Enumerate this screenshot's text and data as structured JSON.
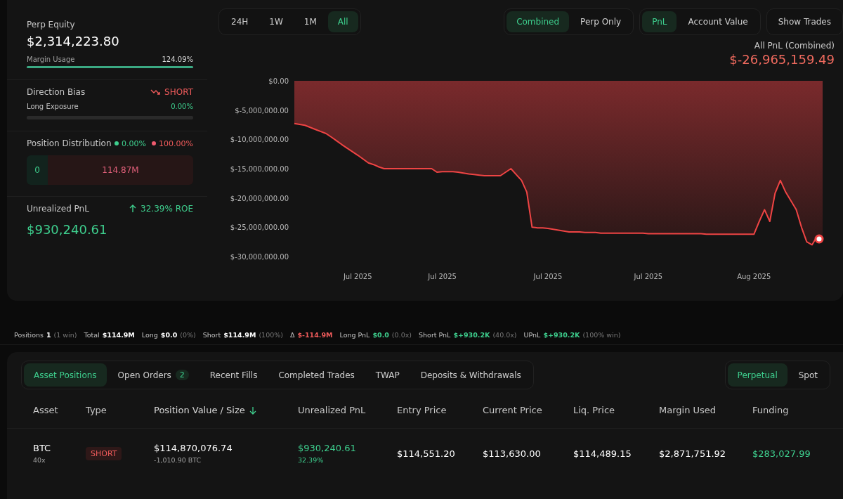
{
  "summary": {
    "perp_equity": {
      "label": "Perp Equity",
      "value": "$2,314,223.80"
    },
    "margin_usage": {
      "label": "Margin Usage",
      "value": "124.09%",
      "level": 1
    },
    "direction_bias": {
      "label": "Direction Bias",
      "value": "SHORT"
    },
    "long_exposure": {
      "label": "Long Exposure",
      "value": "0.00%",
      "level": 0
    },
    "position_distribution": {
      "label": "Position Distribution",
      "long_pct": "0.00%",
      "short_pct": "100.00%",
      "long_value": "0",
      "short_value": "114.87M"
    },
    "unrealized_pnl": {
      "label": "Unrealized PnL",
      "roe": "32.39% ROE",
      "value": "$930,240.61"
    }
  },
  "range_tabs": [
    {
      "label": "24H",
      "selected": false
    },
    {
      "label": "1W",
      "selected": false
    },
    {
      "label": "1M",
      "selected": false
    },
    {
      "label": "All",
      "selected": true
    }
  ],
  "mode_tabs": [
    {
      "label": "Combined",
      "selected": true
    },
    {
      "label": "Perp Only",
      "selected": false
    }
  ],
  "metric_tabs": [
    {
      "label": "PnL",
      "selected": true
    },
    {
      "label": "Account Value",
      "selected": false
    }
  ],
  "show_trades": "Show Trades",
  "chart_header": {
    "label": "All PnL (Combined)",
    "value": "$-26,965,159.49"
  },
  "chart_data": {
    "type": "area",
    "categories": [
      null,
      null,
      null,
      null,
      null,
      null,
      null,
      null,
      null,
      null,
      null,
      null,
      "Jul 2025",
      null,
      null,
      null,
      null,
      null,
      null,
      null,
      null,
      null,
      null,
      null,
      null,
      null,
      null,
      null,
      "Jul 2025",
      null,
      null,
      null,
      null,
      null,
      null,
      null,
      null,
      null,
      null,
      null,
      null,
      null,
      null,
      null,
      null,
      null,
      null,
      null,
      "Jul 2025",
      null,
      null,
      null,
      null,
      null,
      null,
      null,
      null,
      null,
      null,
      null,
      null,
      null,
      null,
      null,
      null,
      null,
      null,
      "Jul 2025",
      null,
      null,
      null,
      null,
      null,
      null,
      null,
      null,
      null,
      null,
      null,
      null,
      null,
      null,
      null,
      null,
      null,
      null,
      null,
      "Aug 2025",
      null,
      null,
      null,
      null,
      null,
      null,
      null,
      null,
      null,
      null,
      null,
      null,
      null
    ],
    "series": [
      {
        "color": "#ef4444",
        "values": [
          -7300000,
          -7450000,
          -7600000,
          -7950000,
          -8300000,
          -8650000,
          -9000000,
          -9600000,
          -10250000,
          -10900000,
          -11500000,
          -12100000,
          -12700000,
          -13350000,
          -14000000,
          -14300000,
          -14700000,
          -15000000,
          -15000000,
          -15000000,
          -15000000,
          -15000000,
          -15000000,
          -15000000,
          -15000000,
          -15000000,
          -15000000,
          -15600000,
          -15500000,
          -15500000,
          -15500000,
          -15600000,
          -15750000,
          -15900000,
          -16000000,
          -16100000,
          -16200000,
          -16200000,
          -16200000,
          -16200000,
          -15600000,
          -15000000,
          -16000000,
          -17000000,
          -19000000,
          -25000000,
          -25100000,
          -25100000,
          -25200000,
          -25350000,
          -25500000,
          -25650000,
          -25800000,
          -25800000,
          -25800000,
          -25900000,
          -25900000,
          -25900000,
          -26000000,
          -26000000,
          -26000000,
          -26000000,
          -26000000,
          -26000000,
          -26000000,
          -26000000,
          -26000000,
          -26100000,
          -26100000,
          -26100000,
          -26100000,
          -26100000,
          -26100000,
          -26100000,
          -26100000,
          -26100000,
          -26100000,
          -26100000,
          -26200000,
          -26200000,
          -26200000,
          -26200000,
          -26200000,
          -26200000,
          -26200000,
          -26200000,
          -26200000,
          -26200000,
          -24000000,
          -22000000,
          -24000000,
          -19200000,
          -17000000,
          -19000000,
          -20500000,
          -22000000,
          -25000000,
          -27500000,
          -28000000,
          -26500000,
          -27000000
        ]
      }
    ],
    "ylim": [
      -30000000,
      0
    ],
    "yticks": [
      {
        "value": 0,
        "label": "$0.00"
      },
      {
        "value": -5000000,
        "label": "$-5,000,000.00"
      },
      {
        "value": -10000000,
        "label": "$-10,000,000.00"
      },
      {
        "value": -15000000,
        "label": "$-15,000,000.00"
      },
      {
        "value": -20000000,
        "label": "$-20,000,000.00"
      },
      {
        "value": -25000000,
        "label": "$-25,000,000.00"
      },
      {
        "value": -30000000,
        "label": "$-30,000,000.00"
      }
    ]
  },
  "stats": [
    {
      "label": "Positions",
      "value": "1",
      "note": "(1 win)",
      "color": "#ffffff"
    },
    {
      "label": "Total",
      "value": "$114.9M",
      "color": "#ffffff"
    },
    {
      "label": "Long",
      "value": "$0.0",
      "note": "(0%)",
      "color": "#ffffff"
    },
    {
      "label": "Short",
      "value": "$114.9M",
      "note": "(100%)",
      "color": "#ffffff"
    },
    {
      "label": "Δ",
      "value": "$-114.9M",
      "color": "#ef5b5b"
    },
    {
      "label": "Long PnL",
      "value": "$0.0",
      "note": "(0.0x)",
      "color": "#3ecf8e"
    },
    {
      "label": "Short PnL",
      "value": "$+930.2K",
      "note": "(40.0x)",
      "color": "#3ecf8e"
    },
    {
      "label": "UPnL",
      "value": "$+930.2K",
      "note": "(100% win)",
      "color": "#3ecf8e"
    }
  ],
  "position_tabs": [
    {
      "label": "Asset Positions",
      "selected": true
    },
    {
      "label": "Open Orders",
      "badge": "2",
      "selected": false
    },
    {
      "label": "Recent Fills",
      "selected": false
    },
    {
      "label": "Completed Trades",
      "selected": false
    },
    {
      "label": "TWAP",
      "selected": false
    },
    {
      "label": "Deposits & Withdrawals",
      "selected": false
    }
  ],
  "market_tabs": [
    {
      "label": "Perpetual",
      "selected": true
    },
    {
      "label": "Spot",
      "selected": false
    }
  ],
  "table": {
    "columns": [
      {
        "label": "Asset",
        "sorted": false
      },
      {
        "label": "Type",
        "sorted": false
      },
      {
        "label": "Position Value / Size",
        "sorted": true
      },
      {
        "label": "Unrealized PnL",
        "sorted": false
      },
      {
        "label": "Entry Price",
        "sorted": false
      },
      {
        "label": "Current Price",
        "sorted": false
      },
      {
        "label": "Liq. Price",
        "sorted": false
      },
      {
        "label": "Margin Used",
        "sorted": false
      },
      {
        "label": "Funding",
        "sorted": false
      }
    ],
    "rows": [
      {
        "asset": "BTC",
        "leverage": "40x",
        "type": "SHORT",
        "position_value": "$114,870,076.74",
        "size": "-1,010.90 BTC",
        "unrealized_pnl": "$930,240.61",
        "unrealized_pct": "32.39%",
        "pnl_positive": true,
        "entry_price": "$114,551.20",
        "current_price": "$113,630.00",
        "liq_price": "$114,489.15",
        "margin_used": "$2,871,751.92",
        "funding": "$283,027.99",
        "funding_positive": true
      }
    ]
  }
}
